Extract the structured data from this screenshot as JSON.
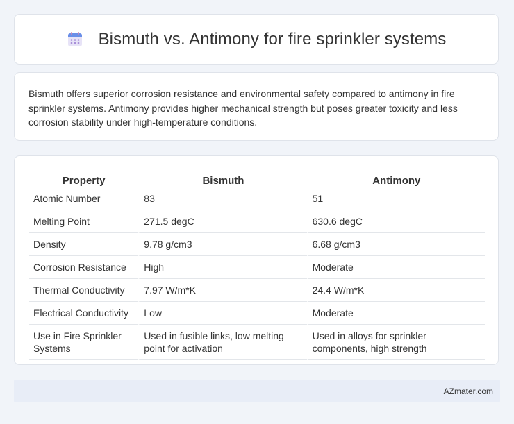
{
  "header": {
    "title": "Bismuth vs. Antimony for fire sprinkler systems",
    "icon": "calendar-icon"
  },
  "summary": {
    "text": "Bismuth offers superior corrosion resistance and environmental safety compared to antimony in fire sprinkler systems. Antimony provides higher mechanical strength but poses greater toxicity and less corrosion stability under high-temperature conditions."
  },
  "table": {
    "headers": [
      "Property",
      "Bismuth",
      "Antimony"
    ],
    "rows": [
      [
        "Atomic Number",
        "83",
        "51"
      ],
      [
        "Melting Point",
        "271.5 degC",
        "630.6 degC"
      ],
      [
        "Density",
        "9.78 g/cm3",
        "6.68 g/cm3"
      ],
      [
        "Corrosion Resistance",
        "High",
        "Moderate"
      ],
      [
        "Thermal Conductivity",
        "7.97 W/m*K",
        "24.4 W/m*K"
      ],
      [
        "Electrical Conductivity",
        "Low",
        "Moderate"
      ],
      [
        "Use in Fire Sprinkler Systems",
        "Used in fusible links, low melting point for activation",
        "Used in alloys for sprinkler components, high strength"
      ]
    ]
  },
  "footer": {
    "brand": "AZmater.com"
  }
}
